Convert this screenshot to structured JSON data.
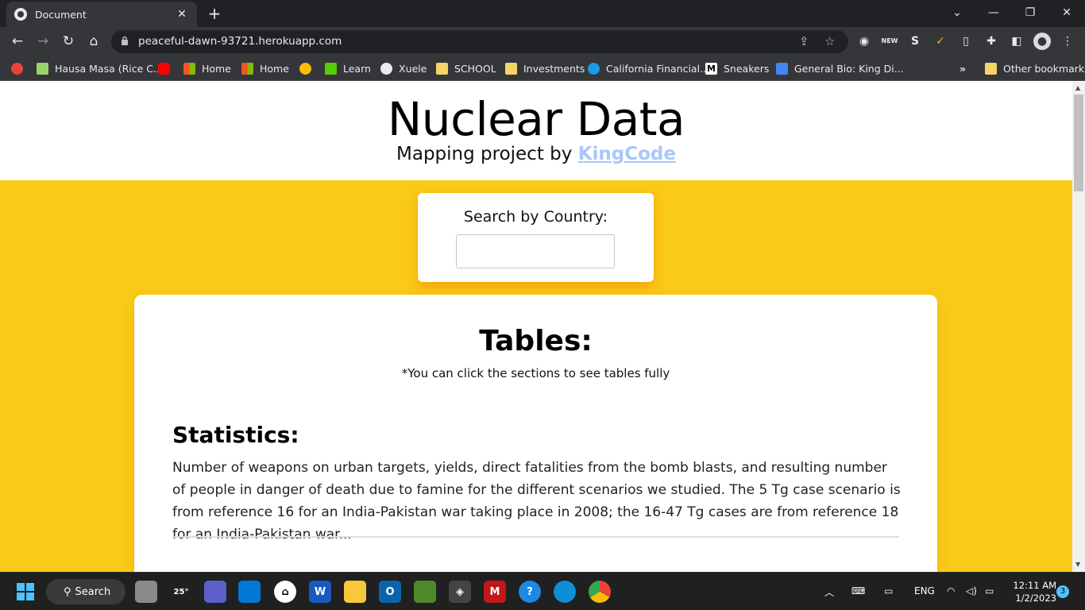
{
  "browser": {
    "tab_title": "Document",
    "url": "peaceful-dawn-93721.herokuapp.com",
    "bookmarks": [
      {
        "label": "Hausa Masa (Rice C...",
        "color": "#9ad36b"
      },
      {
        "label": "",
        "color": "#ff0000"
      },
      {
        "label": "Home",
        "color": "#f35325"
      },
      {
        "label": "Home",
        "color": "#f35325"
      },
      {
        "label": "",
        "color": "#ea4335"
      },
      {
        "label": "Learn",
        "color": "#58cc02"
      },
      {
        "label": "Xuele",
        "color": "#e8eaed"
      },
      {
        "label": "SCHOOL",
        "color": "#f6d365"
      },
      {
        "label": "Investments",
        "color": "#f6d365"
      },
      {
        "label": "California Financial...",
        "color": "#1a9be6"
      },
      {
        "label": "Sneakers",
        "color": "#ffffff"
      },
      {
        "label": "General Bio: King Di...",
        "color": "#4285f4"
      }
    ],
    "overflow": "»",
    "other_bookmarks": "Other bookmarks"
  },
  "page": {
    "title": "Nuclear Data",
    "subtitle_prefix": "Mapping project by",
    "subtitle_link": "KingCode",
    "search_label": "Search by Country:",
    "search_value": "",
    "tables_heading": "Tables:",
    "tables_note": "*You can click the sections to see tables fully",
    "statistics_heading": "Statistics:",
    "statistics_text": "Number of weapons on urban targets, yields, direct fatalities from the bomb blasts, and resulting number of people in danger of death due to famine for the different scenarios we studied. The 5 Tg case scenario is from reference 16 for an India-Pakistan war taking place in 2008; the 16-47 Tg cases are from reference 18 for an India-Pakistan war..."
  },
  "taskbar": {
    "search_label": "Search",
    "weather_temp": "25°",
    "lang": "ENG",
    "time": "12:11 AM",
    "date": "1/2/2023",
    "notification_count": "3"
  },
  "colors": {
    "accent_yellow": "#f9ca18",
    "link": "#a8c7fa"
  }
}
